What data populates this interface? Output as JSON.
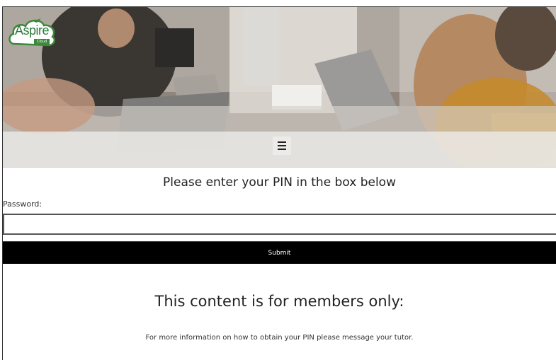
{
  "header": {
    "logo": {
      "text": "Aspire",
      "sub": "Cloud",
      "icon": "aspire-cloud-logo"
    },
    "menu_icon": "hamburger-menu-icon"
  },
  "hero": {
    "image": "office-meeting-photo"
  },
  "form": {
    "heading": "Please enter your PIN in the box below",
    "password_label": "Password:",
    "password_value": "",
    "submit_label": "Submit"
  },
  "members": {
    "heading": "This content is for members only:",
    "info": "For more information on how to obtain your PIN please message your tutor."
  },
  "colors": {
    "button_bg": "#000000",
    "button_text": "#ffffff",
    "logo_green": "#2d7a3a"
  }
}
